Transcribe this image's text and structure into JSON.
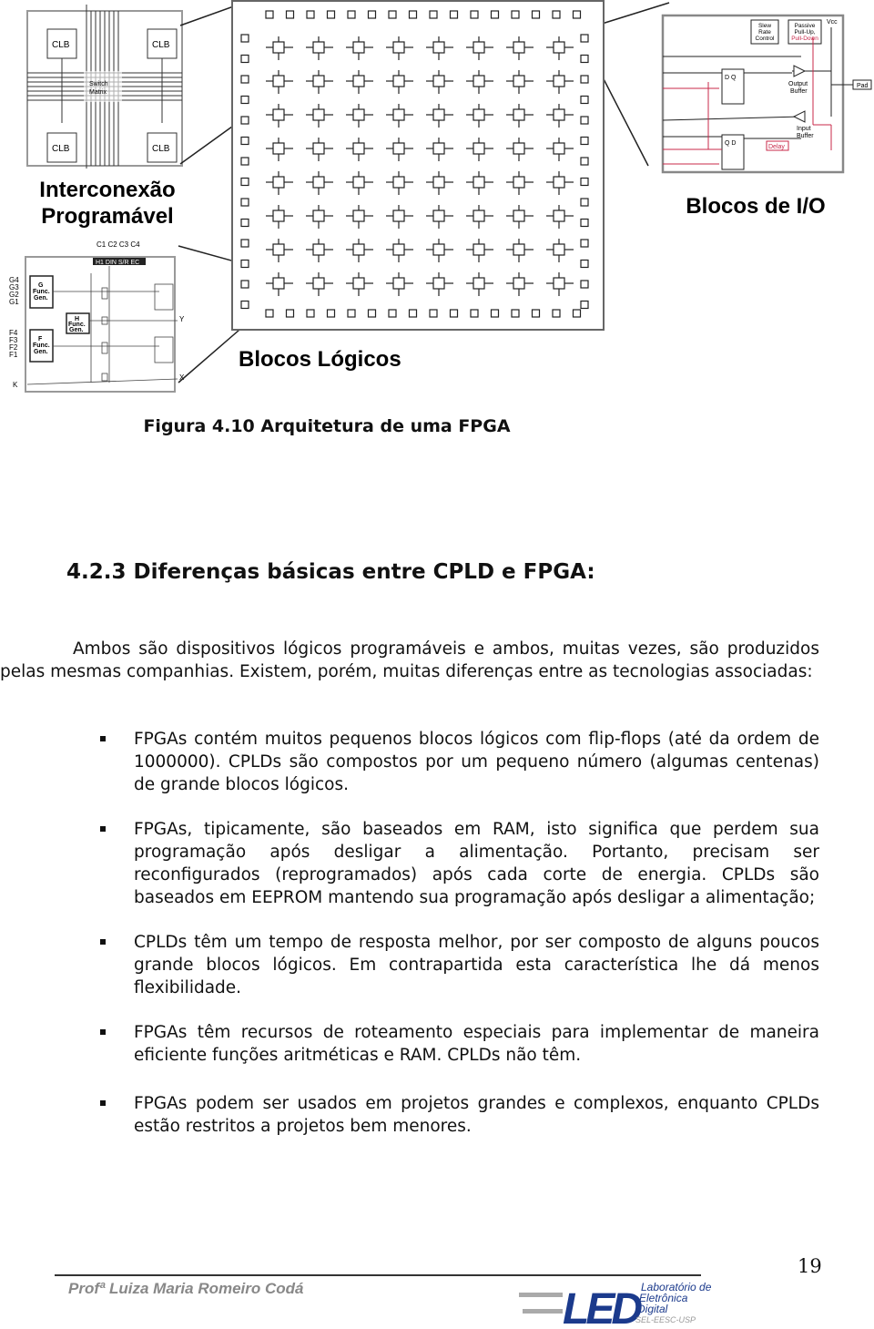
{
  "figure": {
    "overview": {
      "clb_labels": [
        "CLB",
        "CLB",
        "CLB",
        "CLB"
      ],
      "switch_matrix": [
        "Switch",
        "Matrix"
      ],
      "title_lines": [
        "Interconexão",
        "Programável"
      ]
    },
    "logic_blocks_title": "Blocos Lógicos",
    "io_title": "Blocos de I/O",
    "clb_detail": {
      "top_inputs": "C1 C2 C3 C4",
      "control_bus": "H1 DIN S/R EC",
      "g_inputs": [
        "G4",
        "G3",
        "G2",
        "G1"
      ],
      "f_inputs": [
        "F4",
        "F3",
        "F2",
        "F1"
      ],
      "k_input": "K",
      "g_gen": [
        "G",
        "Func.",
        "Gen."
      ],
      "f_gen": [
        "F",
        "Func.",
        "Gen."
      ],
      "h_gen": [
        "H",
        "Func.",
        "Gen."
      ],
      "outputs": [
        "Y",
        "X"
      ]
    },
    "io_block": {
      "slew": [
        "Slew",
        "Rate",
        "Control"
      ],
      "pull": [
        "Passive",
        "Pull-Up,",
        "Pull-Down"
      ],
      "vcc": "Vcc",
      "pad": "Pad",
      "output_buffer": [
        "Output",
        "Buffer"
      ],
      "input_buffer": [
        "Input",
        "Buffer"
      ],
      "delay": "Delay",
      "ff_top": "D  Q",
      "ff_bottom": "Q  D",
      "accent_color": "#c8284a"
    },
    "caption": "Figura 4.10 Arquitetura de uma FPGA"
  },
  "section": {
    "heading": "4.2.3 Diferenças básicas entre CPLD e FPGA:",
    "intro": "Ambos são dispositivos lógicos programáveis e ambos, muitas vezes, são produzidos pelas mesmas companhias. Existem, porém, muitas diferenças entre as tecnologias associadas:",
    "bullets": [
      "FPGAs contém muitos pequenos blocos lógicos com flip-flops (até da ordem de 1000000). CPLDs são compostos por um pequeno número (algumas centenas) de grande blocos lógicos.",
      "FPGAs, tipicamente, são baseados em RAM, isto significa que perdem sua programação após desligar a alimentação. Portanto, precisam ser reconfigurados (reprogramados) após cada corte de energia. CPLDs são baseados em EEPROM mantendo sua programação após desligar a alimentação;",
      "CPLDs têm um tempo de resposta melhor, por ser composto de alguns poucos grande blocos lógicos. Em contrapartida esta característica lhe dá menos flexibilidade.",
      "FPGAs têm recursos de roteamento especiais para implementar de maneira eficiente funções aritméticas e RAM. CPLDs não têm.",
      "FPGAs podem ser usados em projetos grandes e complexos, enquanto CPLDs estão restritos a projetos bem menores."
    ]
  },
  "footer": {
    "author": "Profª Luiza Maria Romeiro Codá",
    "page_number": "19",
    "logo": {
      "mark": "LED",
      "lines": [
        "Laboratório de",
        "Eletrônica",
        "Digital",
        "SEL-EESC-USP"
      ],
      "color": "#1b3a8c"
    }
  }
}
